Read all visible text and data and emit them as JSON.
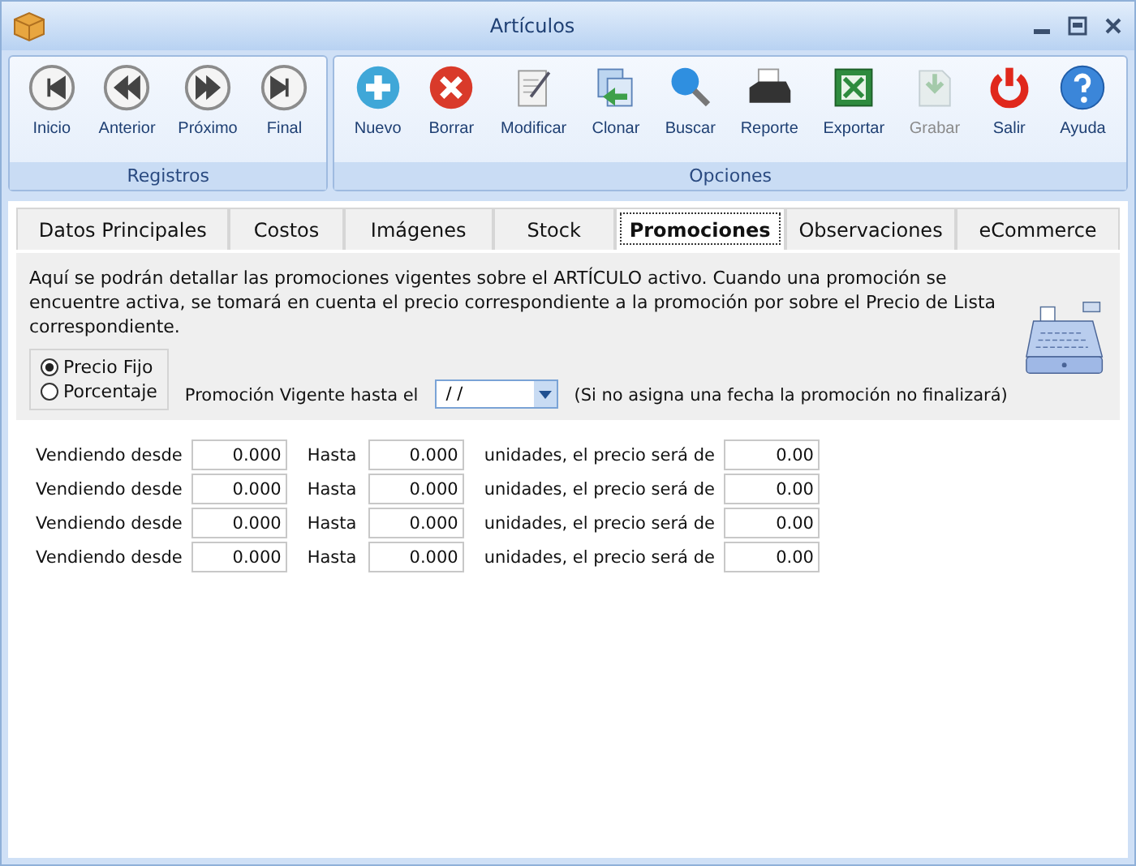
{
  "window": {
    "title": "Artículos"
  },
  "toolbar": {
    "groups": [
      {
        "label": "Registros",
        "buttons": [
          {
            "label": "Inicio",
            "kind": "first",
            "disabled": false
          },
          {
            "label": "Anterior",
            "kind": "prev",
            "disabled": false
          },
          {
            "label": "Próximo",
            "kind": "next",
            "disabled": false
          },
          {
            "label": "Final",
            "kind": "last",
            "disabled": false
          }
        ]
      },
      {
        "label": "Opciones",
        "buttons": [
          {
            "label": "Nuevo",
            "kind": "new",
            "disabled": false
          },
          {
            "label": "Borrar",
            "kind": "delete",
            "disabled": false
          },
          {
            "label": "Modificar",
            "kind": "edit",
            "disabled": false
          },
          {
            "label": "Clonar",
            "kind": "clone",
            "disabled": false
          },
          {
            "label": "Buscar",
            "kind": "search",
            "disabled": false
          },
          {
            "label": "Reporte",
            "kind": "print",
            "disabled": false
          },
          {
            "label": "Exportar",
            "kind": "excel",
            "disabled": false
          },
          {
            "label": "Grabar",
            "kind": "save",
            "disabled": true
          },
          {
            "label": "Salir",
            "kind": "exit",
            "disabled": false
          },
          {
            "label": "Ayuda",
            "kind": "help",
            "disabled": false
          }
        ]
      }
    ]
  },
  "tabs": [
    {
      "label": "Datos Principales",
      "selected": false
    },
    {
      "label": "Costos",
      "selected": false
    },
    {
      "label": "Imágenes",
      "selected": false
    },
    {
      "label": "Stock",
      "selected": false
    },
    {
      "label": "Promociones",
      "selected": true
    },
    {
      "label": "Observaciones",
      "selected": false
    },
    {
      "label": "eCommerce",
      "selected": false
    }
  ],
  "promo": {
    "description": "Aquí se podrán detallar las promociones vigentes sobre el ARTÍCULO activo.  Cuando una promoción se encuentre activa, se tomará en cuenta el precio correspondiente a la promoción por sobre el Precio de Lista correspondiente.",
    "price_type": [
      {
        "label": "Precio Fijo",
        "selected": true
      },
      {
        "label": "Porcentaje",
        "selected": false
      }
    ],
    "date_label": "Promoción Vigente hasta el",
    "date_value": " / /",
    "date_note": "(Si no asigna una fecha la promoción no finalizará)"
  },
  "rows": [
    {
      "from_label": "Vendiendo desde",
      "from": "0.000",
      "to_label": "Hasta",
      "to": "0.000",
      "price_label": "unidades, el precio será de",
      "price": "0.00"
    },
    {
      "from_label": "Vendiendo desde",
      "from": "0.000",
      "to_label": "Hasta",
      "to": "0.000",
      "price_label": "unidades, el precio será de",
      "price": "0.00"
    },
    {
      "from_label": "Vendiendo desde",
      "from": "0.000",
      "to_label": "Hasta",
      "to": "0.000",
      "price_label": "unidades, el precio será de",
      "price": "0.00"
    },
    {
      "from_label": "Vendiendo desde",
      "from": "0.000",
      "to_label": "Hasta",
      "to": "0.000",
      "price_label": "unidades, el precio será de",
      "price": "0.00"
    }
  ]
}
